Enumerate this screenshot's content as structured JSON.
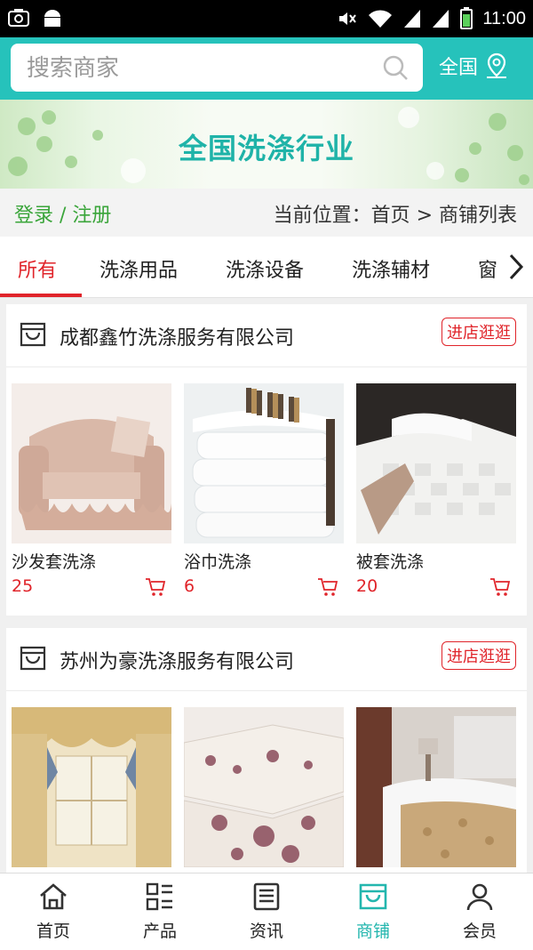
{
  "status_bar": {
    "time": "11:00"
  },
  "search": {
    "placeholder": "搜索商家",
    "region_label": "全国"
  },
  "banner": {
    "title": "全国洗涤行业"
  },
  "location": {
    "login_link": "登录 / 注册",
    "breadcrumb": "当前位置：首页 > 商铺列表"
  },
  "tabs": [
    "所有",
    "洗涤用品",
    "洗涤设备",
    "洗涤辅材",
    "窗"
  ],
  "shops": [
    {
      "name": "成都鑫竹洗涤服务有限公司",
      "visit_label": "进店逛逛",
      "products": [
        {
          "name": "沙发套洗涤",
          "price": "25"
        },
        {
          "name": "浴巾洗涤",
          "price": "6"
        },
        {
          "name": "被套洗涤",
          "price": "20"
        }
      ]
    },
    {
      "name": "苏州为豪洗涤服务有限公司",
      "visit_label": "进店逛逛",
      "products": [
        {
          "name": "",
          "price": ""
        },
        {
          "name": "",
          "price": ""
        },
        {
          "name": "",
          "price": ""
        }
      ]
    }
  ],
  "bottom_nav": [
    {
      "label": "首页",
      "icon": "home-icon"
    },
    {
      "label": "产品",
      "icon": "grid-list-icon"
    },
    {
      "label": "资讯",
      "icon": "news-icon"
    },
    {
      "label": "商铺",
      "icon": "store-icon"
    },
    {
      "label": "会员",
      "icon": "user-icon"
    }
  ],
  "colors": {
    "accent": "#26c2bb",
    "price": "#e0242a",
    "login": "#3aa53a"
  }
}
